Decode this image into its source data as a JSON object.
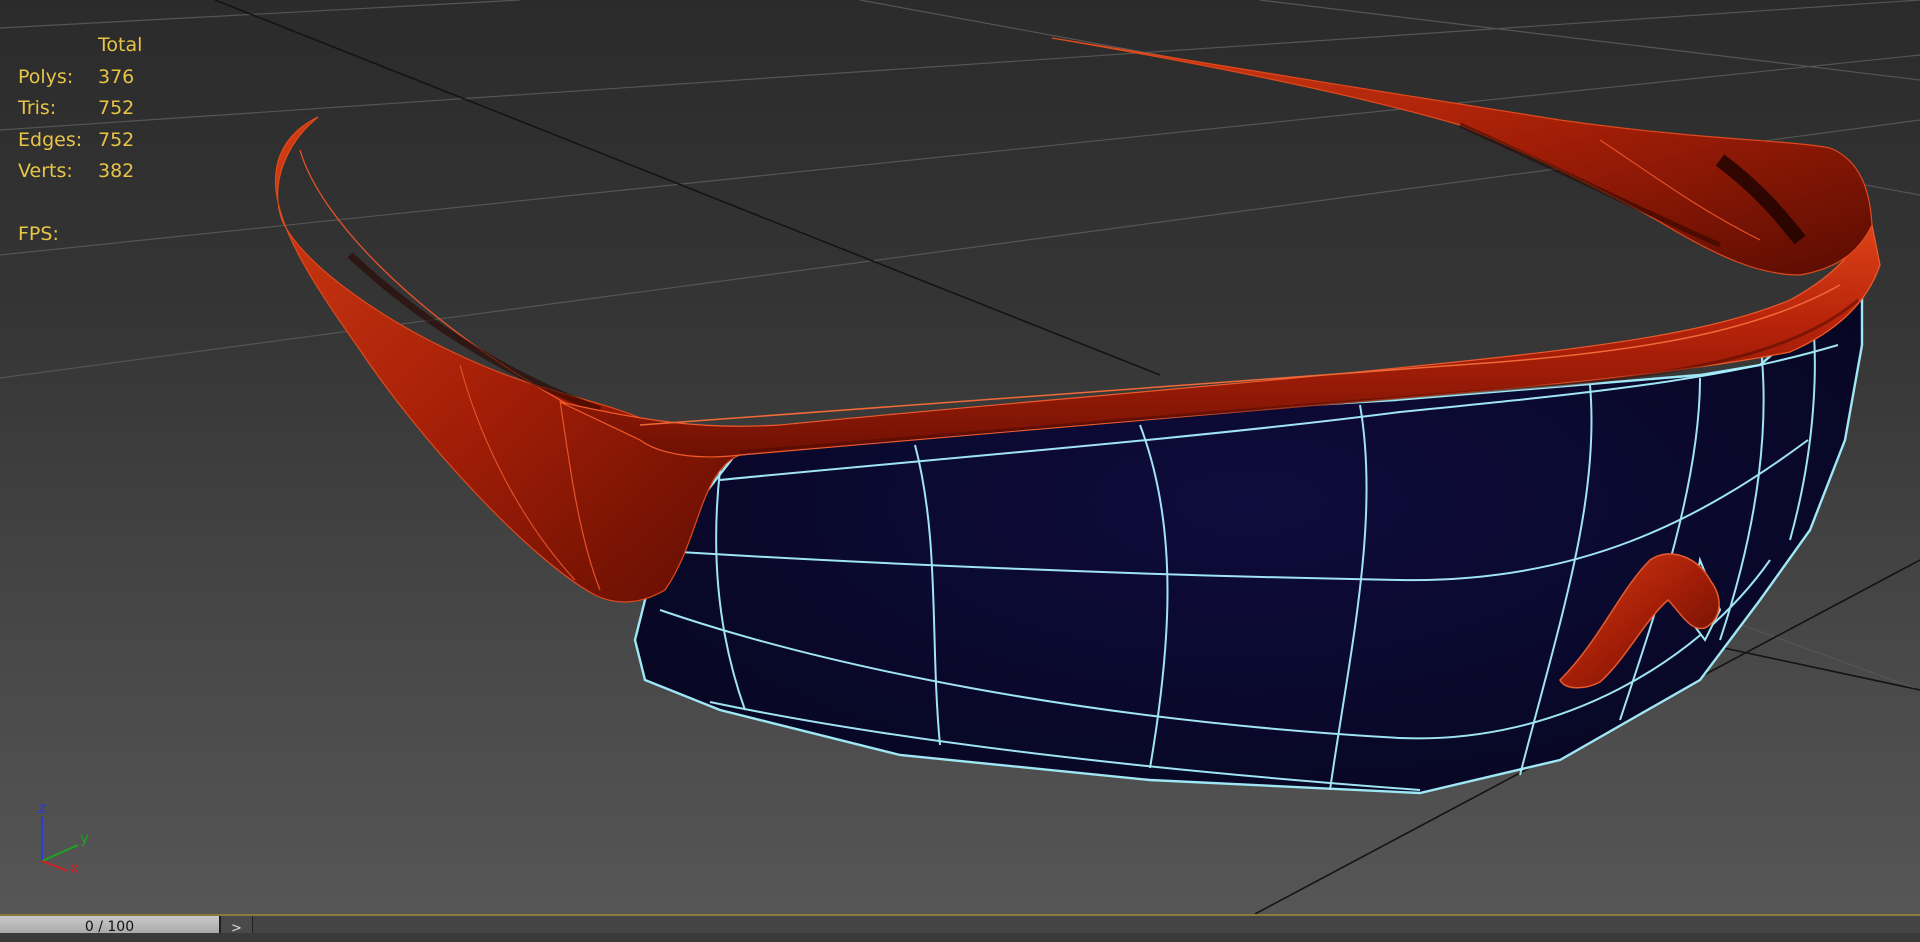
{
  "viewport": {
    "stats": {
      "header": "Total",
      "rows": [
        {
          "label": "Polys:",
          "value": "376"
        },
        {
          "label": "Tris:",
          "value": "752"
        },
        {
          "label": "Edges:",
          "value": "752"
        },
        {
          "label": "Verts:",
          "value": "382"
        }
      ],
      "fps_label": "FPS:"
    },
    "gizmo": {
      "z": "z",
      "y": "y",
      "x": "x"
    },
    "colors": {
      "frame": "#c0270a",
      "lens": "#0b0a33",
      "wire_lens": "#a8f0ff",
      "grid": "#111111",
      "stats_text": "#e8c547"
    }
  },
  "timeline": {
    "slider_label": "0 / 100",
    "next_label": ">"
  }
}
